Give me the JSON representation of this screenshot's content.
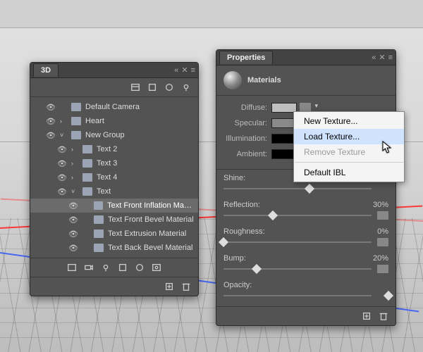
{
  "panel3d": {
    "title": "3D",
    "items": [
      {
        "depth": 1,
        "twist": "",
        "icon": "camera",
        "label": "Default Camera"
      },
      {
        "depth": 1,
        "twist": "›",
        "icon": "mesh",
        "label": "Heart"
      },
      {
        "depth": 1,
        "twist": "˅",
        "icon": "group",
        "label": "New Group"
      },
      {
        "depth": 2,
        "twist": "›",
        "icon": "mesh",
        "label": "Text 2"
      },
      {
        "depth": 2,
        "twist": "›",
        "icon": "mesh",
        "label": "Text 3"
      },
      {
        "depth": 2,
        "twist": "›",
        "icon": "mesh",
        "label": "Text 4"
      },
      {
        "depth": 2,
        "twist": "˅",
        "icon": "mesh",
        "label": "Text"
      },
      {
        "depth": 3,
        "twist": "",
        "icon": "mat",
        "label": "Text Front Inflation Mate...",
        "selected": true
      },
      {
        "depth": 3,
        "twist": "",
        "icon": "mat",
        "label": "Text Front Bevel Material"
      },
      {
        "depth": 3,
        "twist": "",
        "icon": "mat",
        "label": "Text Extrusion Material"
      },
      {
        "depth": 3,
        "twist": "",
        "icon": "mat",
        "label": "Text Back Bevel Material"
      }
    ]
  },
  "props": {
    "title": "Properties",
    "section": "Materials",
    "labels": {
      "diffuse": "Diffuse:",
      "specular": "Specular:",
      "illumination": "Illumination:",
      "ambient": "Ambient:"
    },
    "swatches": {
      "diffuse": "#bfbfbf",
      "specular": "#8a8a8a",
      "illumination": "#000000",
      "ambient": "#000000"
    },
    "sliders": [
      {
        "name": "Shine:",
        "value": "",
        "pct": 52
      },
      {
        "name": "Reflection:",
        "value": "30%",
        "pct": 30
      },
      {
        "name": "Roughness:",
        "value": "0%",
        "pct": 0
      },
      {
        "name": "Bump:",
        "value": "20%",
        "pct": 20
      },
      {
        "name": "Opacity:",
        "value": "",
        "pct": 100
      }
    ]
  },
  "menu": {
    "items": [
      {
        "label": "New Texture...",
        "state": "normal"
      },
      {
        "label": "Load Texture...",
        "state": "hover"
      },
      {
        "label": "Remove Texture",
        "state": "disabled"
      },
      {
        "label": "Default IBL",
        "state": "normal"
      }
    ]
  }
}
